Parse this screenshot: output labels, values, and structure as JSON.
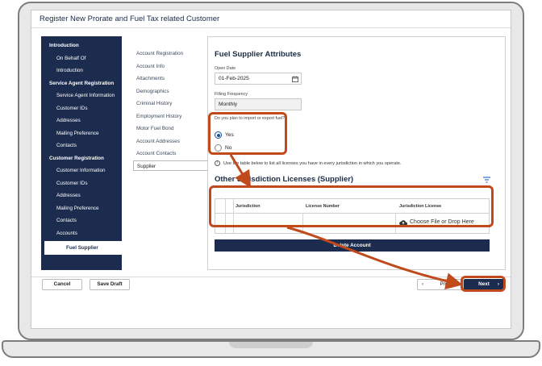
{
  "window": {
    "title": "Register New Prorate and Fuel Tax related Customer"
  },
  "left_nav": {
    "items": [
      {
        "label": "Introduction",
        "type": "header"
      },
      {
        "label": "On Behalf Of",
        "type": "sub"
      },
      {
        "label": "Introduction",
        "type": "sub"
      },
      {
        "label": "Service Agent Registration",
        "type": "header"
      },
      {
        "label": "Service Agent Information",
        "type": "sub"
      },
      {
        "label": "Customer IDs",
        "type": "sub"
      },
      {
        "label": "Addresses",
        "type": "sub"
      },
      {
        "label": "Mailing Preference",
        "type": "sub"
      },
      {
        "label": "Contacts",
        "type": "sub"
      },
      {
        "label": "Customer Registration",
        "type": "header"
      },
      {
        "label": "Customer Information",
        "type": "sub"
      },
      {
        "label": "Customer IDs",
        "type": "sub"
      },
      {
        "label": "Addresses",
        "type": "sub"
      },
      {
        "label": "Mailing Preference",
        "type": "sub"
      },
      {
        "label": "Contacts",
        "type": "sub"
      },
      {
        "label": "Accounts",
        "type": "sub"
      },
      {
        "label": "Fuel Supplier",
        "type": "active"
      }
    ]
  },
  "sub_nav": {
    "items": [
      "Account Registration",
      "Account Info",
      "Attachments",
      "Demographics",
      "Criminal History",
      "Employment History",
      "Motor Fuel Bond",
      "Account Addresses",
      "Account Contacts",
      "Supplier"
    ],
    "active": "Supplier"
  },
  "form": {
    "title": "Fuel Supplier Attributes",
    "open_date": {
      "label": "Open Date",
      "value": "01-Feb-2025"
    },
    "filing_frequency": {
      "label": "Filling Frequency",
      "value": "Monthly"
    },
    "import_export": {
      "question": "Do you plan to import or export fuel?",
      "options": [
        "Yes",
        "No"
      ],
      "selected": "Yes"
    },
    "info_text": "Use the table below to list all licenses you have in every jurisdiction in which you operate."
  },
  "licenses": {
    "title": "Other Jurisdiction Licenses (Supplier)",
    "columns": [
      "Jurisdiction",
      "License Number",
      "Jurisdiction License"
    ],
    "upload_label": "Choose File or Drop Here",
    "delete_label": "Delete Account"
  },
  "footer": {
    "cancel": "Cancel",
    "save_draft": "Save Draft",
    "previous": "Previous",
    "next": "Next"
  },
  "colors": {
    "nav_background": "#1c2c4e",
    "annotation": "#c04a1c",
    "radio_selected": "#1a4f9c"
  }
}
